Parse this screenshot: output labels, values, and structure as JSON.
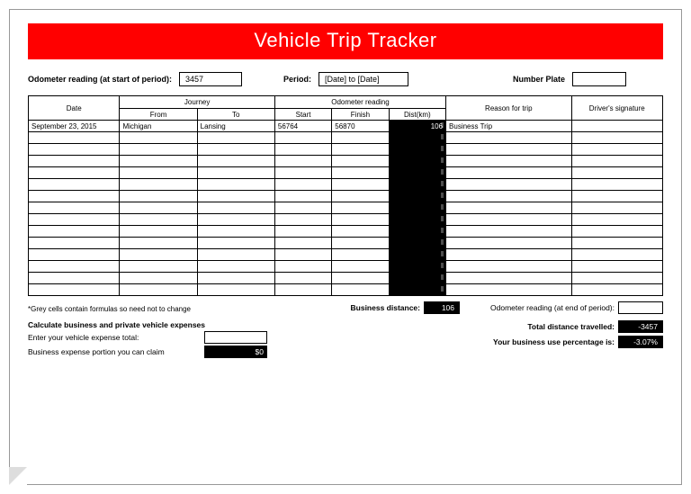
{
  "title": "Vehicle Trip Tracker",
  "header": {
    "odometer_start_label": "Odometer reading (at start of period):",
    "odometer_start_value": "3457",
    "period_label": "Period:",
    "period_value": "[Date] to [Date]",
    "number_plate_label": "Number Plate",
    "number_plate_value": ""
  },
  "table": {
    "headers": {
      "date": "Date",
      "journey": "Journey",
      "from": "From",
      "to": "To",
      "odometer": "Odometer reading",
      "start": "Start",
      "finish": "Finish",
      "dist": "Dist(km)",
      "reason": "Reason for trip",
      "signature": "Driver's signature"
    },
    "rows": [
      {
        "date": "September 23, 2015",
        "from": "Michigan",
        "to": "Lansing",
        "start": "56764",
        "finish": "56870",
        "dist": "106",
        "reason": "Business Trip",
        "sig": ""
      },
      {
        "date": "",
        "from": "",
        "to": "",
        "start": "",
        "finish": "",
        "dist": "",
        "reason": "",
        "sig": ""
      },
      {
        "date": "",
        "from": "",
        "to": "",
        "start": "",
        "finish": "",
        "dist": "",
        "reason": "",
        "sig": ""
      },
      {
        "date": "",
        "from": "",
        "to": "",
        "start": "",
        "finish": "",
        "dist": "",
        "reason": "",
        "sig": ""
      },
      {
        "date": "",
        "from": "",
        "to": "",
        "start": "",
        "finish": "",
        "dist": "",
        "reason": "",
        "sig": ""
      },
      {
        "date": "",
        "from": "",
        "to": "",
        "start": "",
        "finish": "",
        "dist": "",
        "reason": "",
        "sig": ""
      },
      {
        "date": "",
        "from": "",
        "to": "",
        "start": "",
        "finish": "",
        "dist": "",
        "reason": "",
        "sig": ""
      },
      {
        "date": "",
        "from": "",
        "to": "",
        "start": "",
        "finish": "",
        "dist": "",
        "reason": "",
        "sig": ""
      },
      {
        "date": "",
        "from": "",
        "to": "",
        "start": "",
        "finish": "",
        "dist": "",
        "reason": "",
        "sig": ""
      },
      {
        "date": "",
        "from": "",
        "to": "",
        "start": "",
        "finish": "",
        "dist": "",
        "reason": "",
        "sig": ""
      },
      {
        "date": "",
        "from": "",
        "to": "",
        "start": "",
        "finish": "",
        "dist": "",
        "reason": "",
        "sig": ""
      },
      {
        "date": "",
        "from": "",
        "to": "",
        "start": "",
        "finish": "",
        "dist": "",
        "reason": "",
        "sig": ""
      },
      {
        "date": "",
        "from": "",
        "to": "",
        "start": "",
        "finish": "",
        "dist": "",
        "reason": "",
        "sig": ""
      },
      {
        "date": "",
        "from": "",
        "to": "",
        "start": "",
        "finish": "",
        "dist": "",
        "reason": "",
        "sig": ""
      },
      {
        "date": "",
        "from": "",
        "to": "",
        "start": "",
        "finish": "",
        "dist": "",
        "reason": "",
        "sig": ""
      }
    ]
  },
  "footer": {
    "note": "*Grey cells contain formulas so need not to change",
    "business_distance_label": "Business distance:",
    "business_distance_value": "106",
    "odometer_end_label": "Odometer reading (at end of period):",
    "odometer_end_value": "",
    "total_distance_label": "Total distance travelled:",
    "total_distance_value": "-3457",
    "percentage_label": "Your business use percentage is:",
    "percentage_value": "-3.07%",
    "expenses_heading": "Calculate business and private vehicle expenses",
    "expense_total_label": "Enter your vehicle expense total:",
    "expense_total_value": "",
    "business_portion_label": "Business expense portion you can claim",
    "business_portion_value": "$0"
  }
}
